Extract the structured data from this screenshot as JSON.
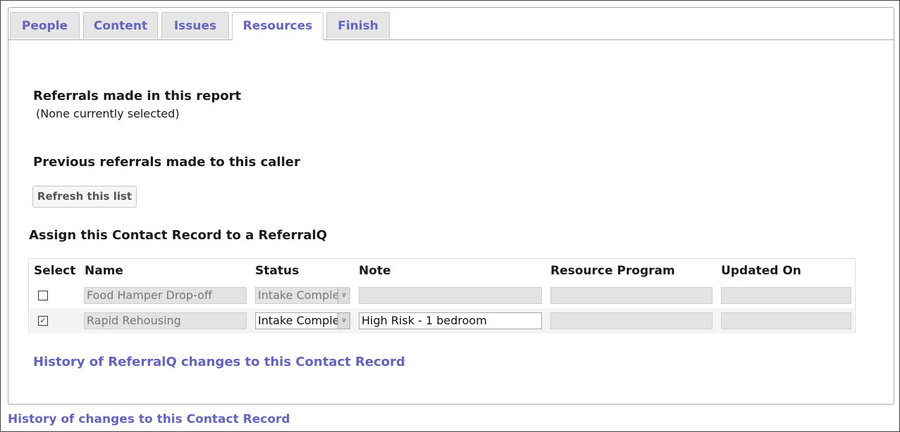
{
  "tabs": [
    {
      "label": "People"
    },
    {
      "label": "Content"
    },
    {
      "label": "Issues"
    },
    {
      "label": "Resources"
    },
    {
      "label": "Finish"
    }
  ],
  "referrals_section": {
    "title": "Referrals made in this report",
    "none_text": "(None currently selected)"
  },
  "previous_section": {
    "title": "Previous referrals made to this caller",
    "refresh_button": "Refresh this list"
  },
  "assign_section": {
    "title": "Assign this Contact Record to a ReferralQ",
    "columns": [
      "Select",
      "Name",
      "Status",
      "Note",
      "Resource Program",
      "Updated On"
    ],
    "rows": [
      {
        "checked": false,
        "check_glyph": "",
        "name": "Food Hamper Drop-off",
        "status": "Intake Complete",
        "note": "",
        "resource_program": "",
        "updated_on": ""
      },
      {
        "checked": true,
        "check_glyph": "✓",
        "name": "Rapid Rehousing",
        "status": "Intake Complete",
        "note": "High Risk - 1 bedroom",
        "resource_program": "",
        "updated_on": ""
      }
    ],
    "history_link": "History of ReferralQ changes to this Contact Record"
  },
  "footer": {
    "history_link": "History of changes to this Contact Record"
  },
  "colors": {
    "link": "#6363c4",
    "tab_bg": "#e6e6e6",
    "disabled_field": "#e3e3e3"
  }
}
